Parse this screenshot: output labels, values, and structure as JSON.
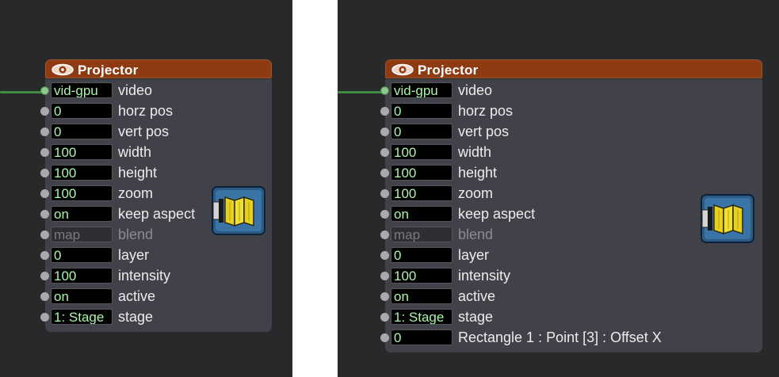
{
  "colors": {
    "canvas_bg": "#28292b",
    "title_bar": "#8e3b14",
    "actor_body": "#414249",
    "field_text": "#aaf5aa",
    "wire": "#3f8a3f",
    "separator": "#ffffff"
  },
  "actors": [
    {
      "title": "Projector",
      "icon": "projector-map-icon",
      "inputs": [
        {
          "value": "vid-gpu",
          "label": "video",
          "connected": true
        },
        {
          "value": "0",
          "label": "horz pos"
        },
        {
          "value": "0",
          "label": "vert pos"
        },
        {
          "value": "100",
          "label": "width"
        },
        {
          "value": "100",
          "label": "height"
        },
        {
          "value": "100",
          "label": "zoom"
        },
        {
          "value": "on",
          "label": "keep aspect"
        },
        {
          "value": "map",
          "label": "blend",
          "disabled": true
        },
        {
          "value": "0",
          "label": "layer"
        },
        {
          "value": "100",
          "label": "intensity"
        },
        {
          "value": "on",
          "label": "active"
        },
        {
          "value": "1: Stage",
          "label": "stage"
        }
      ]
    },
    {
      "title": "Projector",
      "icon": "projector-map-icon",
      "inputs": [
        {
          "value": "vid-gpu",
          "label": "video",
          "connected": true
        },
        {
          "value": "0",
          "label": "horz pos"
        },
        {
          "value": "0",
          "label": "vert pos"
        },
        {
          "value": "100",
          "label": "width"
        },
        {
          "value": "100",
          "label": "height"
        },
        {
          "value": "100",
          "label": "zoom"
        },
        {
          "value": "on",
          "label": "keep aspect"
        },
        {
          "value": "map",
          "label": "blend",
          "disabled": true
        },
        {
          "value": "0",
          "label": "layer"
        },
        {
          "value": "100",
          "label": "intensity"
        },
        {
          "value": "on",
          "label": "active"
        },
        {
          "value": "1: Stage",
          "label": "stage"
        },
        {
          "value": "0",
          "label": "Rectangle 1 : Point [3] : Offset X"
        }
      ]
    }
  ]
}
